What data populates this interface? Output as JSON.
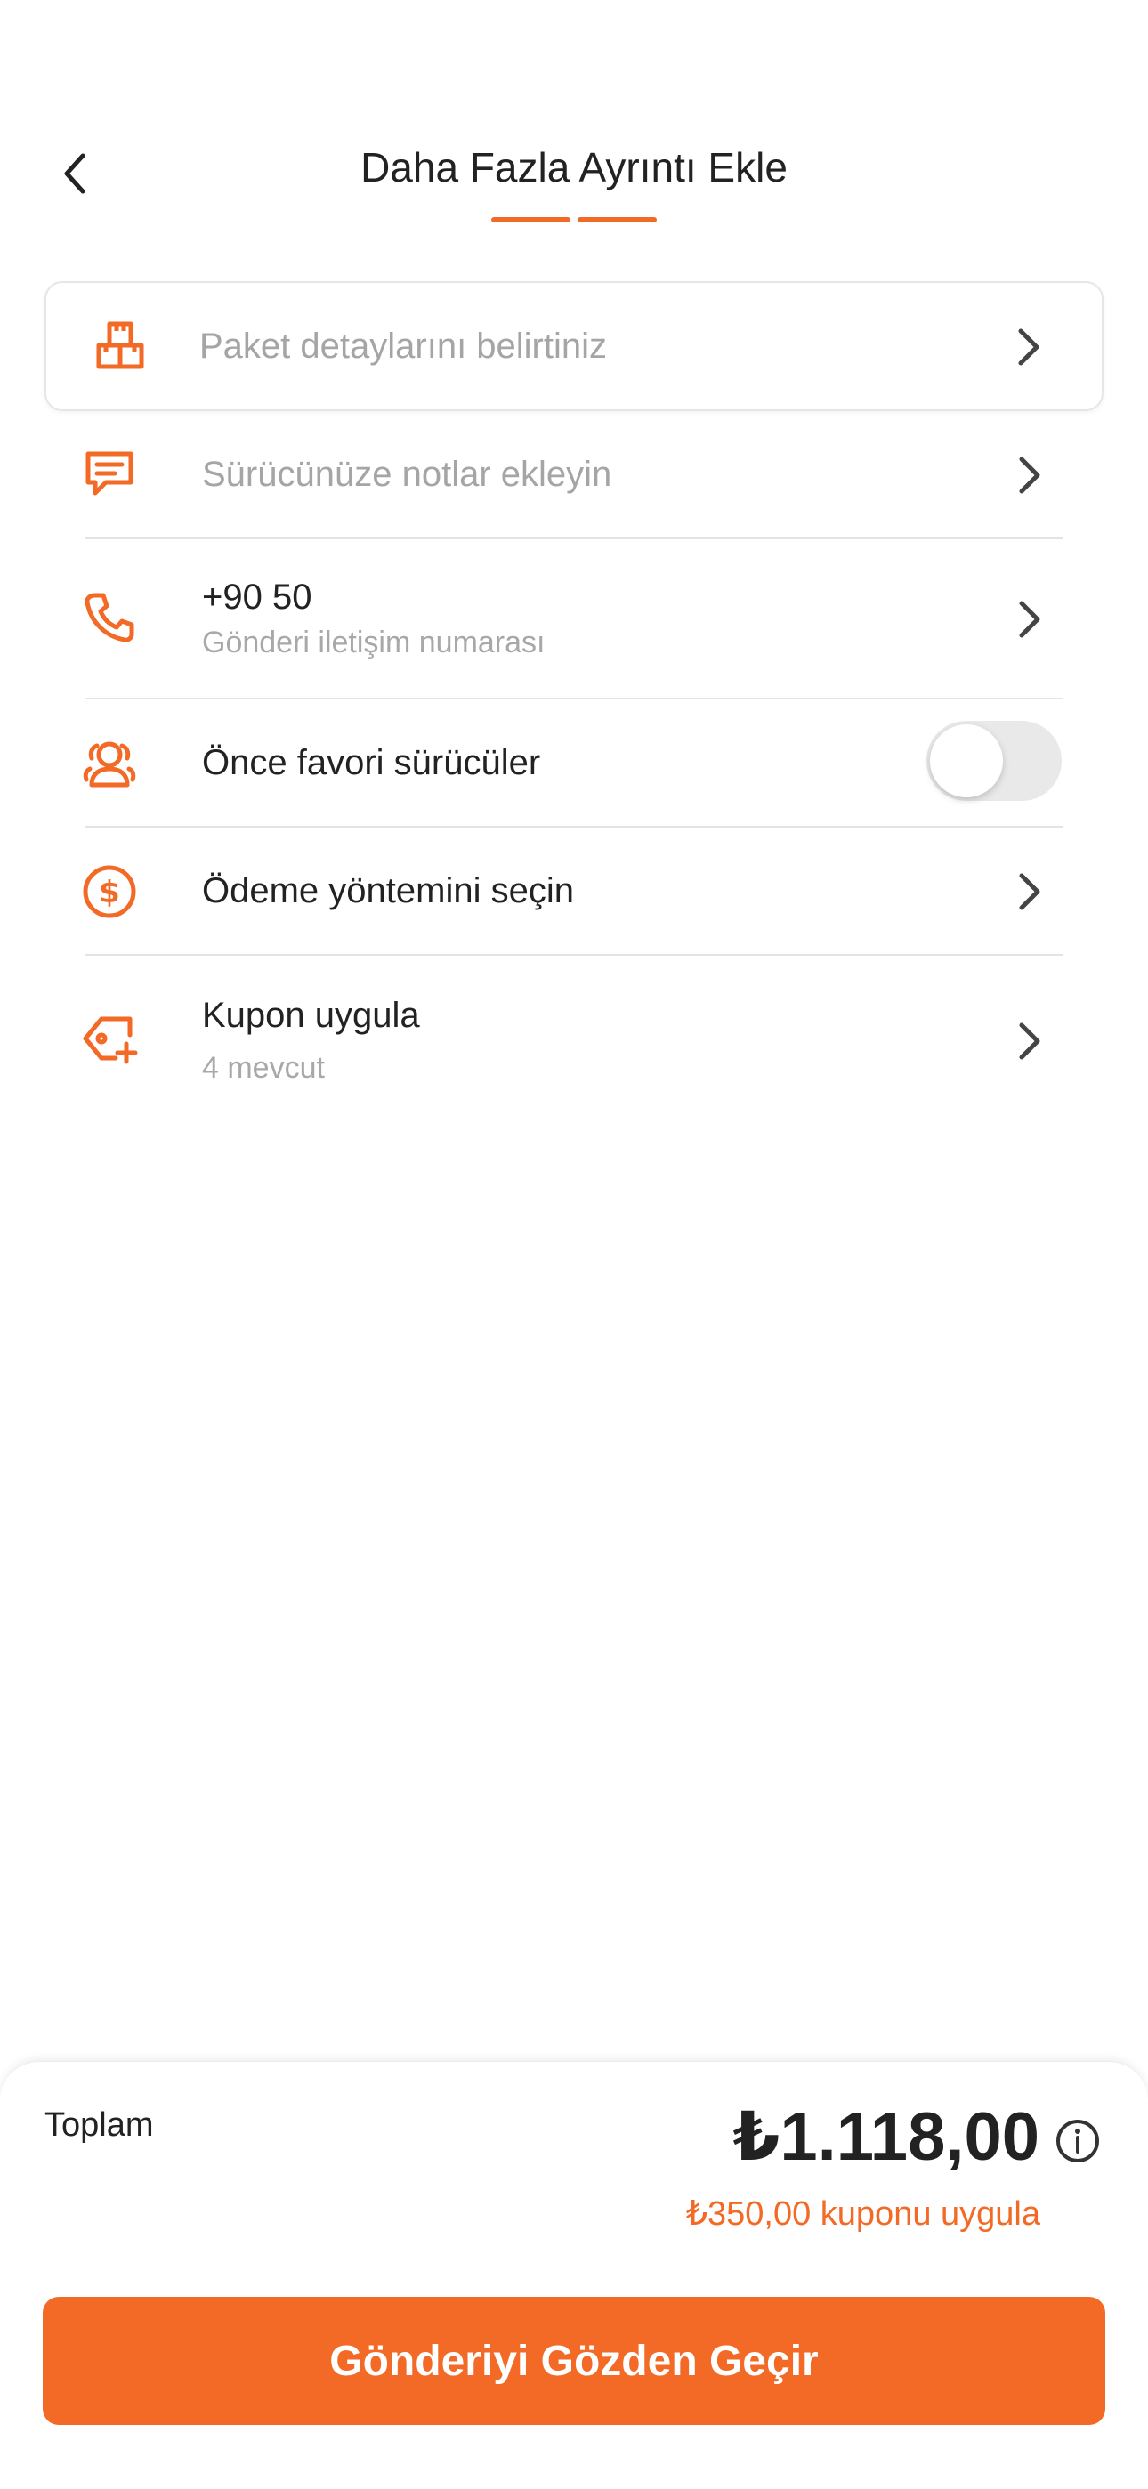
{
  "header": {
    "title": "Daha Fazla Ayrıntı Ekle",
    "progress_steps": 2
  },
  "rows": {
    "package": {
      "label": "Paket detaylarını belirtiniz",
      "icon": "package-icon"
    },
    "notes": {
      "label": "Sürücünüze notlar ekleyin",
      "icon": "message-icon"
    },
    "phone": {
      "value": "+90 50",
      "sublabel": "Gönderi iletişim numarası",
      "icon": "phone-icon"
    },
    "favorite": {
      "label": "Önce favori sürücüler",
      "toggle_on": false,
      "icon": "favorite-drivers-icon"
    },
    "payment": {
      "label": "Ödeme yöntemini seçin",
      "icon": "dollar-circle-icon"
    },
    "coupon": {
      "label": "Kupon uygula",
      "sublabel": "4 mevcut",
      "icon": "tag-plus-icon"
    }
  },
  "footer": {
    "total_label": "Toplam",
    "total_amount": "₺1.118,00",
    "coupon_link": "₺350,00 kuponu uygula",
    "button_label": "Gönderiyi Gözden Geçir"
  },
  "colors": {
    "accent": "#f26a25",
    "text": "#222222",
    "muted": "#a5a5a5",
    "divider": "#e4e4e4"
  }
}
